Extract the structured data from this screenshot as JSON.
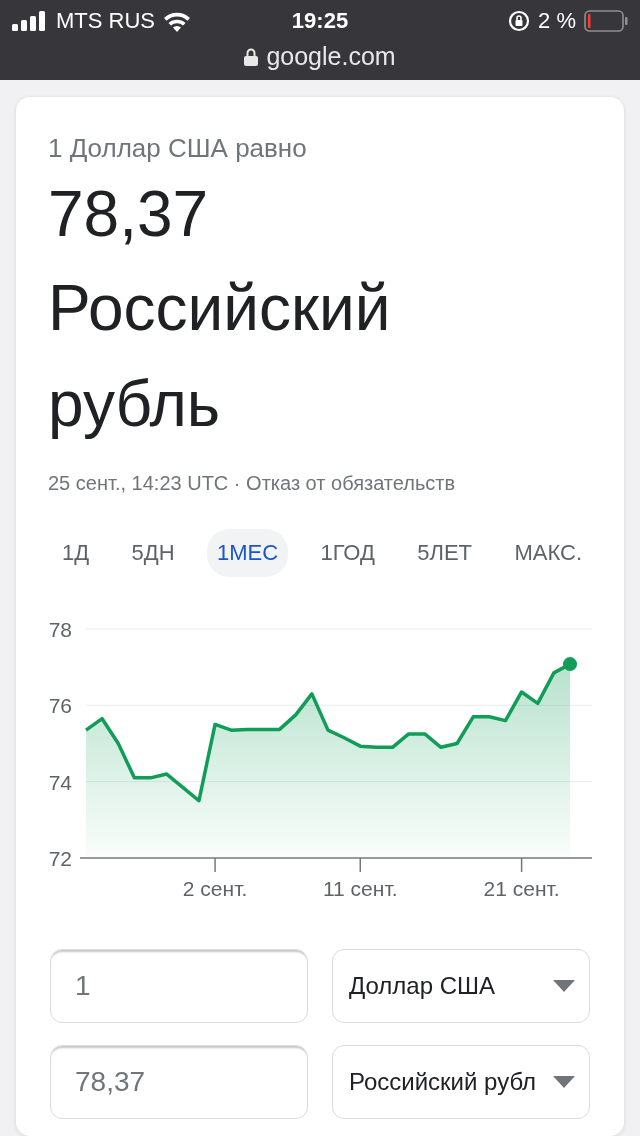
{
  "status_bar": {
    "carrier": "MTS RUS",
    "time": "19:25",
    "battery": "2 %"
  },
  "address_bar": {
    "url": "google.com"
  },
  "converter": {
    "caption": "1 Доллар США равно",
    "amount": "78,37",
    "currency": "Российский рубль",
    "timestamp": "25 сент., 14:23 UTC · ",
    "disclaimer": "Отказ от обязательств"
  },
  "ranges": [
    {
      "label": "1Д",
      "selected": false
    },
    {
      "label": "5ДН",
      "selected": false
    },
    {
      "label": "1МЕС",
      "selected": true
    },
    {
      "label": "1ГОД",
      "selected": false
    },
    {
      "label": "5ЛЕТ",
      "selected": false
    },
    {
      "label": "МАКС.",
      "selected": false
    }
  ],
  "chart": {
    "chart_data": {
      "type": "area",
      "categories": [
        null,
        null,
        null,
        null,
        null,
        null,
        null,
        null,
        "2 сент.",
        null,
        null,
        null,
        null,
        null,
        null,
        null,
        null,
        "11 сент.",
        null,
        null,
        null,
        null,
        null,
        null,
        null,
        null,
        null,
        "21 сент.",
        null,
        null,
        null
      ],
      "series": [
        {
          "color": "#0f9d58",
          "values": [
            75.35,
            75.65,
            75.0,
            74.1,
            74.1,
            74.2,
            73.85,
            73.5,
            75.5,
            75.35,
            75.37,
            75.37,
            75.37,
            75.75,
            76.3,
            75.35,
            75.15,
            74.93,
            74.9,
            74.9,
            75.25,
            75.25,
            74.9,
            75.0,
            75.7,
            75.7,
            75.6,
            76.35,
            76.05,
            76.85,
            77.08
          ]
        }
      ],
      "ylim": [
        72,
        78
      ],
      "yticks": [
        72,
        74,
        76,
        78
      ]
    }
  },
  "fields": [
    {
      "value": "1",
      "currency": "Доллар США"
    },
    {
      "value": "78,37",
      "currency": "Российский рубл"
    }
  ]
}
